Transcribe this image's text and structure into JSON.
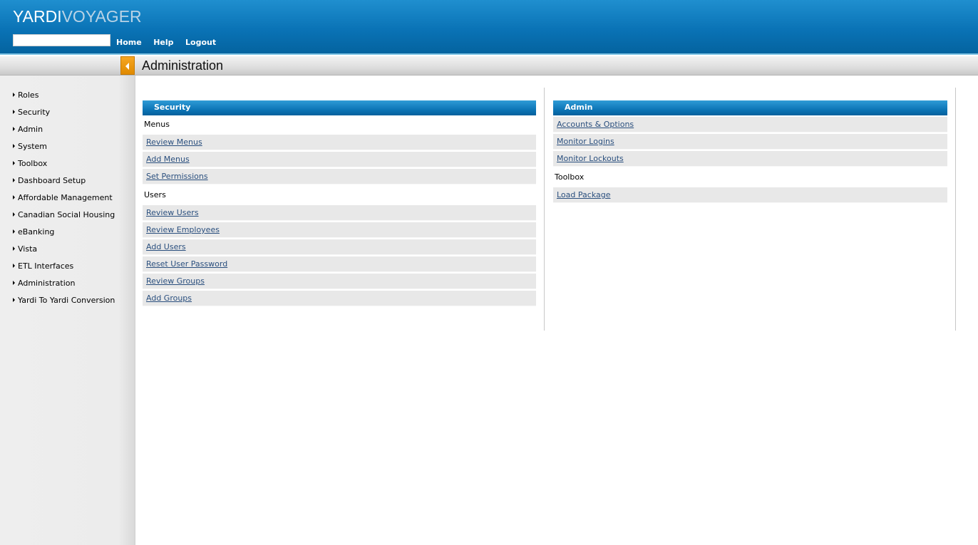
{
  "header": {
    "logo_part1": "YARDI",
    "logo_part2": "VOYAGER",
    "search_value": "",
    "nav": [
      "Home",
      "Help",
      "Logout"
    ]
  },
  "page": {
    "title": "Administration"
  },
  "sidebar": {
    "items": [
      "Roles",
      "Security",
      "Admin",
      "System",
      "Toolbox",
      "Dashboard Setup",
      "Affordable Management",
      "Canadian Social Housing",
      "eBanking",
      "Vista",
      "ETL Interfaces",
      "Administration",
      "Yardi To Yardi Conversion"
    ]
  },
  "security": {
    "title": "Security",
    "menus_label": "Menus",
    "menus": [
      "Review Menus",
      "Add Menus",
      "Set Permissions"
    ],
    "users_label": "Users",
    "users": [
      "Review Users",
      "Review Employees",
      "Add Users",
      "Reset User Password",
      "Review Groups",
      "Add Groups"
    ]
  },
  "admin": {
    "title": "Admin",
    "links": [
      "Accounts & Options",
      "Monitor Logins",
      "Monitor Lockouts"
    ],
    "toolbox_label": "Toolbox",
    "toolbox": [
      "Load Package"
    ]
  },
  "colors": {
    "header_blue": "#0a73b6",
    "accent_orange": "#f5a623",
    "link": "#2a4f7e",
    "row_bg": "#e8e8e8"
  }
}
